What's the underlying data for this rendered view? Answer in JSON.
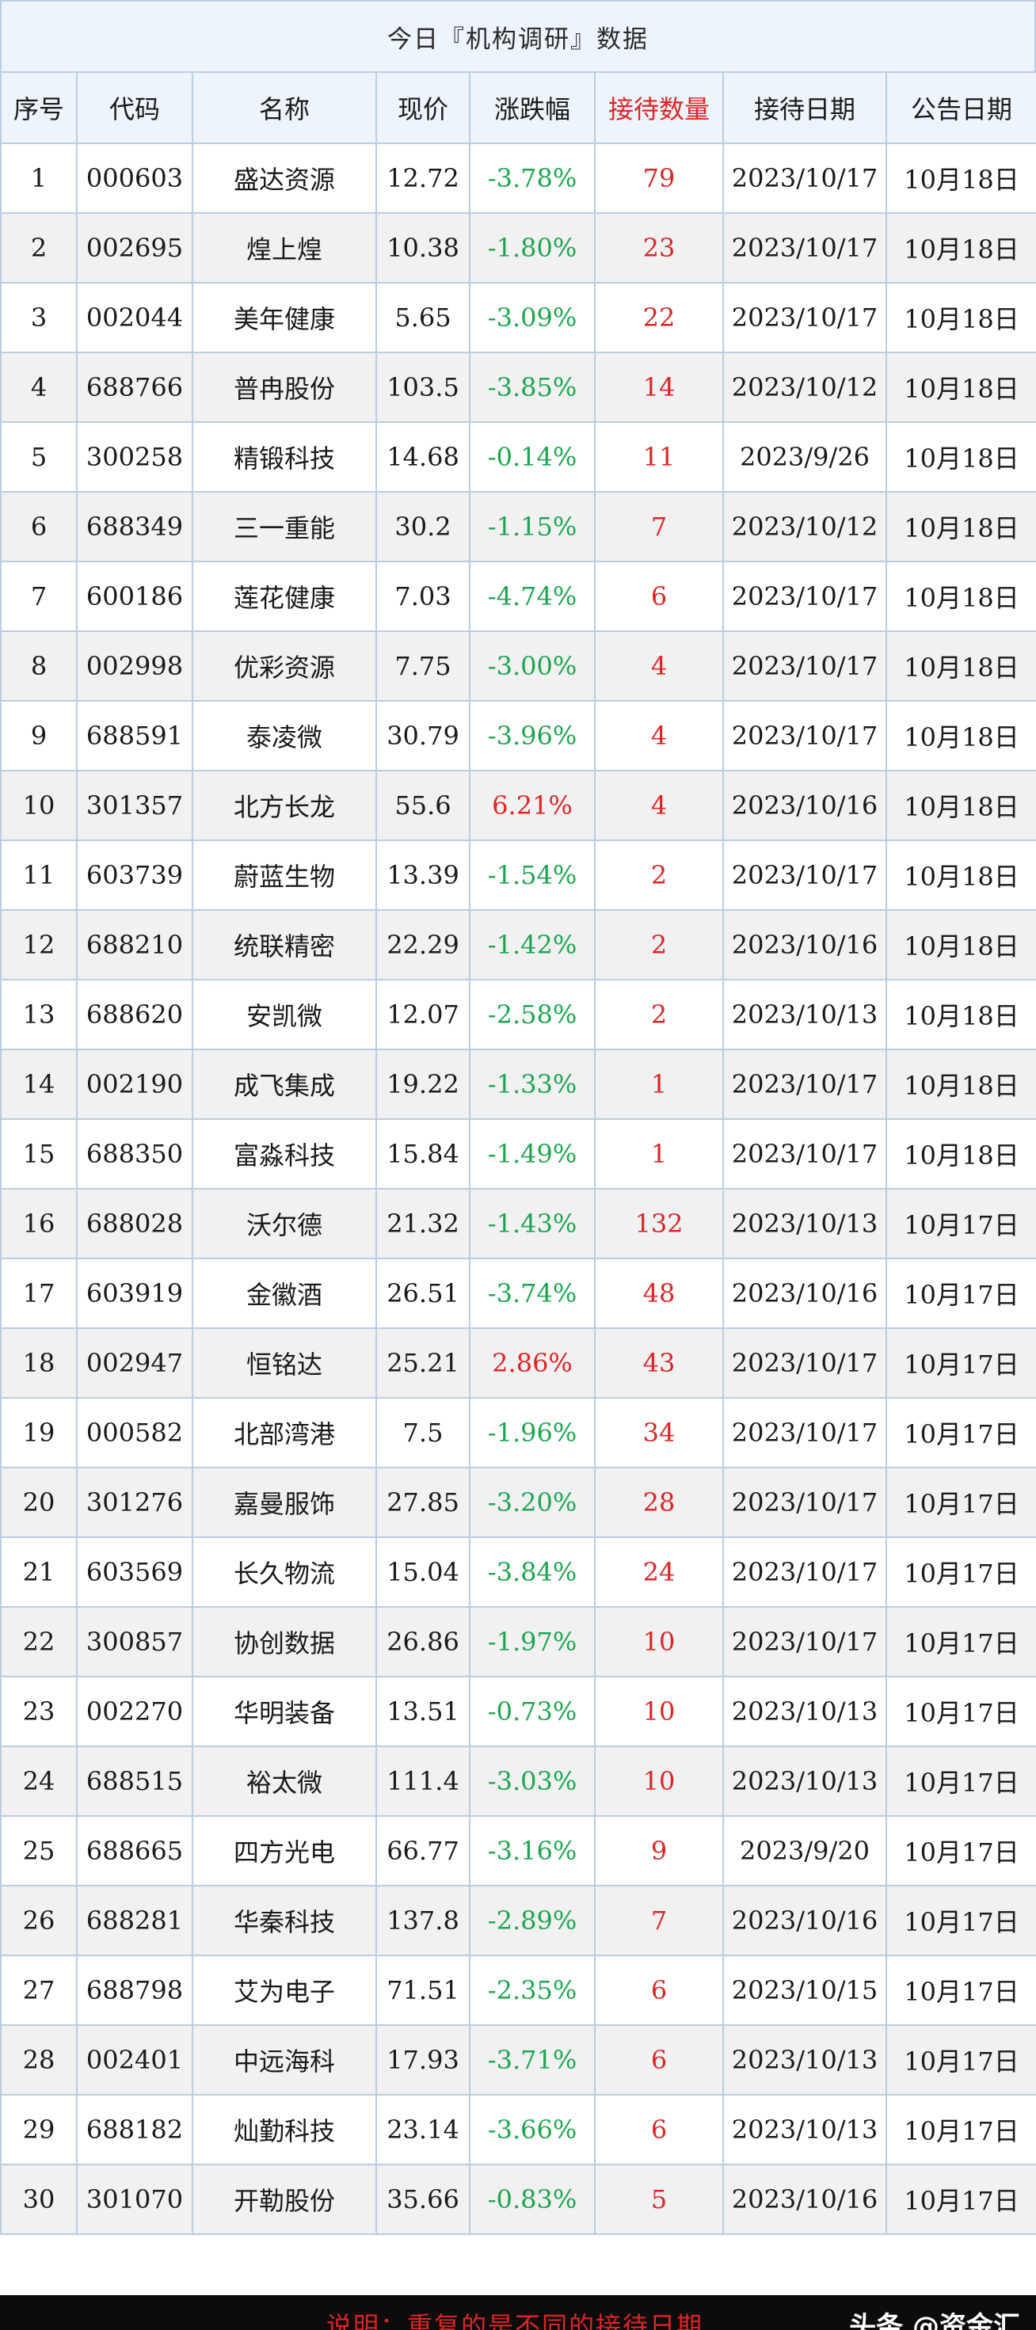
{
  "title": "今日『机构调研』数据",
  "columns": [
    "序号",
    "代码",
    "名称",
    "现价",
    "涨跌幅",
    "接待数量",
    "接待日期",
    "公告日期"
  ],
  "colors": {
    "up": "#e02424",
    "down": "#1fa551",
    "header_bg": "#eef4fb",
    "border": "#b9cde3"
  },
  "rows": [
    [
      "1",
      "000603",
      "盛达资源",
      "12.72",
      "-3.78%",
      "79",
      "2023/10/17",
      "10月18日"
    ],
    [
      "2",
      "002695",
      "煌上煌",
      "10.38",
      "-1.80%",
      "23",
      "2023/10/17",
      "10月18日"
    ],
    [
      "3",
      "002044",
      "美年健康",
      "5.65",
      "-3.09%",
      "22",
      "2023/10/17",
      "10月18日"
    ],
    [
      "4",
      "688766",
      "普冉股份",
      "103.5",
      "-3.85%",
      "14",
      "2023/10/12",
      "10月18日"
    ],
    [
      "5",
      "300258",
      "精锻科技",
      "14.68",
      "-0.14%",
      "11",
      "2023/9/26",
      "10月18日"
    ],
    [
      "6",
      "688349",
      "三一重能",
      "30.2",
      "-1.15%",
      "7",
      "2023/10/12",
      "10月18日"
    ],
    [
      "7",
      "600186",
      "莲花健康",
      "7.03",
      "-4.74%",
      "6",
      "2023/10/17",
      "10月18日"
    ],
    [
      "8",
      "002998",
      "优彩资源",
      "7.75",
      "-3.00%",
      "4",
      "2023/10/17",
      "10月18日"
    ],
    [
      "9",
      "688591",
      "泰凌微",
      "30.79",
      "-3.96%",
      "4",
      "2023/10/17",
      "10月18日"
    ],
    [
      "10",
      "301357",
      "北方长龙",
      "55.6",
      "6.21%",
      "4",
      "2023/10/16",
      "10月18日"
    ],
    [
      "11",
      "603739",
      "蔚蓝生物",
      "13.39",
      "-1.54%",
      "2",
      "2023/10/17",
      "10月18日"
    ],
    [
      "12",
      "688210",
      "统联精密",
      "22.29",
      "-1.42%",
      "2",
      "2023/10/16",
      "10月18日"
    ],
    [
      "13",
      "688620",
      "安凯微",
      "12.07",
      "-2.58%",
      "2",
      "2023/10/13",
      "10月18日"
    ],
    [
      "14",
      "002190",
      "成飞集成",
      "19.22",
      "-1.33%",
      "1",
      "2023/10/17",
      "10月18日"
    ],
    [
      "15",
      "688350",
      "富淼科技",
      "15.84",
      "-1.49%",
      "1",
      "2023/10/17",
      "10月18日"
    ],
    [
      "16",
      "688028",
      "沃尔德",
      "21.32",
      "-1.43%",
      "132",
      "2023/10/13",
      "10月17日"
    ],
    [
      "17",
      "603919",
      "金徽酒",
      "26.51",
      "-3.74%",
      "48",
      "2023/10/16",
      "10月17日"
    ],
    [
      "18",
      "002947",
      "恒铭达",
      "25.21",
      "2.86%",
      "43",
      "2023/10/17",
      "10月17日"
    ],
    [
      "19",
      "000582",
      "北部湾港",
      "7.5",
      "-1.96%",
      "34",
      "2023/10/17",
      "10月17日"
    ],
    [
      "20",
      "301276",
      "嘉曼服饰",
      "27.85",
      "-3.20%",
      "28",
      "2023/10/17",
      "10月17日"
    ],
    [
      "21",
      "603569",
      "长久物流",
      "15.04",
      "-3.84%",
      "24",
      "2023/10/17",
      "10月17日"
    ],
    [
      "22",
      "300857",
      "协创数据",
      "26.86",
      "-1.97%",
      "10",
      "2023/10/17",
      "10月17日"
    ],
    [
      "23",
      "002270",
      "华明装备",
      "13.51",
      "-0.73%",
      "10",
      "2023/10/13",
      "10月17日"
    ],
    [
      "24",
      "688515",
      "裕太微",
      "111.4",
      "-3.03%",
      "10",
      "2023/10/13",
      "10月17日"
    ],
    [
      "25",
      "688665",
      "四方光电",
      "66.77",
      "-3.16%",
      "9",
      "2023/9/20",
      "10月17日"
    ],
    [
      "26",
      "688281",
      "华秦科技",
      "137.8",
      "-2.89%",
      "7",
      "2023/10/16",
      "10月17日"
    ],
    [
      "27",
      "688798",
      "艾为电子",
      "71.51",
      "-2.35%",
      "6",
      "2023/10/15",
      "10月17日"
    ],
    [
      "28",
      "002401",
      "中远海科",
      "17.93",
      "-3.71%",
      "6",
      "2023/10/13",
      "10月17日"
    ],
    [
      "29",
      "688182",
      "灿勤科技",
      "23.14",
      "-3.66%",
      "6",
      "2023/10/13",
      "10月17日"
    ],
    [
      "30",
      "301070",
      "开勒股份",
      "35.66",
      "-0.83%",
      "5",
      "2023/10/16",
      "10月17日"
    ]
  ],
  "footer": {
    "note": "说明：重复的是不同的接待日期",
    "brand": "头条 @资金汇"
  }
}
